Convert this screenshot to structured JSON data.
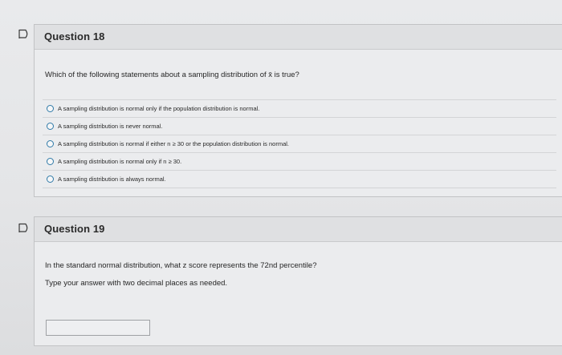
{
  "questions": [
    {
      "title": "Question 18",
      "prompt": "Which of the following statements about a sampling distribution of x̄ is true?",
      "choices": [
        "A sampling distribution is normal only if the population distribution is normal.",
        "A sampling distribution is never normal.",
        "A sampling distribution is normal if either n ≥ 30 or the population distribution is normal.",
        "A sampling distribution is normal only if n ≥ 30.",
        "A sampling distribution is always normal."
      ]
    },
    {
      "title": "Question 19",
      "prompt": "In the standard normal distribution, what z score represents the 72nd percentile?",
      "instruction": "Type your answer with two decimal places as needed.",
      "answer_value": ""
    }
  ],
  "icons": {
    "flag": "flag-icon",
    "accent_color": "#2f7aa8"
  }
}
